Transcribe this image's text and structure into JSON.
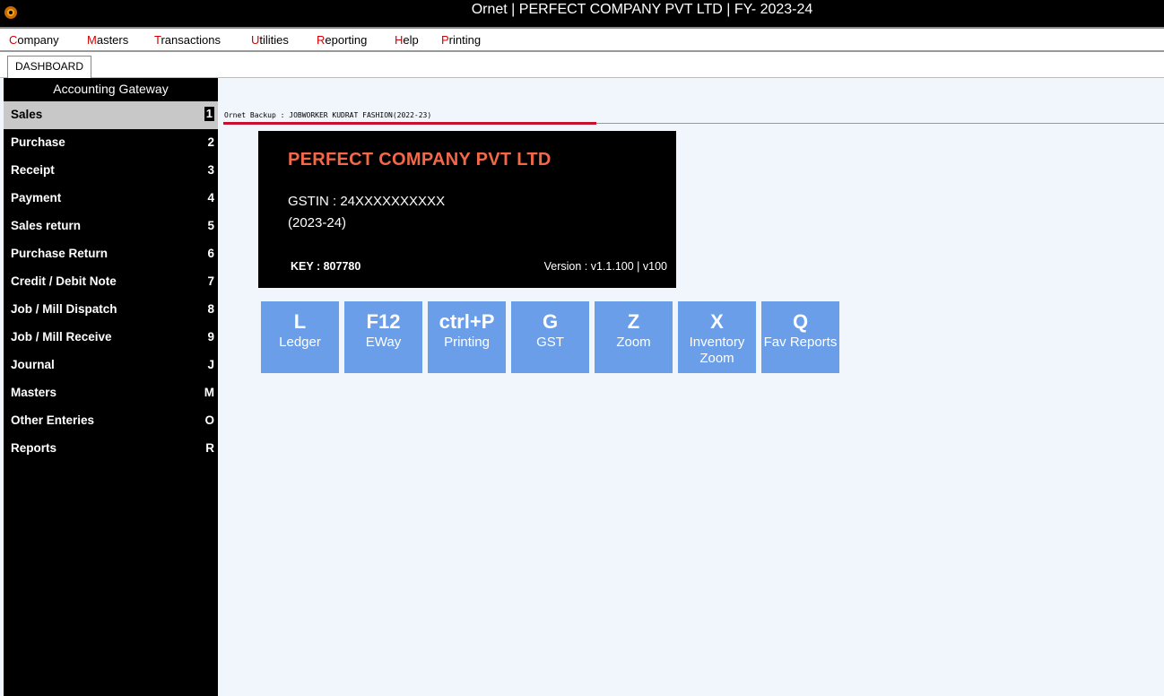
{
  "window": {
    "title": "Ornet | PERFECT COMPANY PVT LTD | FY- 2023-24",
    "icon": "app-logo-icon"
  },
  "menu": [
    {
      "acc": "C",
      "rest": "ompany"
    },
    {
      "acc": "M",
      "rest": "asters"
    },
    {
      "acc": "T",
      "rest": "ransactions"
    },
    {
      "acc": "U",
      "rest": "tilities"
    },
    {
      "acc": "R",
      "rest": "eporting"
    },
    {
      "acc": "H",
      "rest": "elp"
    },
    {
      "acc": "P",
      "rest": "rinting"
    }
  ],
  "tabs": [
    {
      "label": "DASHBOARD"
    }
  ],
  "sidebar": {
    "title": "Accounting Gateway",
    "items": [
      {
        "label": "Sales",
        "key": "1"
      },
      {
        "label": "Purchase",
        "key": "2"
      },
      {
        "label": "Receipt",
        "key": "3"
      },
      {
        "label": "Payment",
        "key": "4"
      },
      {
        "label": "Sales return",
        "key": "5"
      },
      {
        "label": "Purchase Return",
        "key": "6"
      },
      {
        "label": "Credit / Debit Note",
        "key": "7"
      },
      {
        "label": "Job / Mill Dispatch",
        "key": "8"
      },
      {
        "label": "Job / Mill Receive",
        "key": "9"
      },
      {
        "label": "Journal",
        "key": "J"
      },
      {
        "label": "Masters",
        "key": "M"
      },
      {
        "label": "Other Enteries",
        "key": "O"
      },
      {
        "label": "Reports",
        "key": "R"
      }
    ]
  },
  "backup": {
    "text": "Ornet Backup : JOBWORKER KUDRAT FASHION(2022-23)"
  },
  "company": {
    "name": "PERFECT COMPANY PVT LTD",
    "gstin": "GSTIN : 24XXXXXXXXXX",
    "fy": "(2023-24)",
    "key": "KEY : 807780",
    "version": "Version : v1.1.100 | v100"
  },
  "tiles": [
    {
      "key": "L",
      "label": "Ledger"
    },
    {
      "key": "F12",
      "label": "EWay"
    },
    {
      "key": "ctrl+P",
      "label": "Printing"
    },
    {
      "key": "G",
      "label": "GST"
    },
    {
      "key": "Z",
      "label": "Zoom"
    },
    {
      "key": "X",
      "label": "Inventory Zoom"
    },
    {
      "key": "Q",
      "label": "Fav Reports"
    }
  ],
  "colors": {
    "sidebar_bg": "#000000",
    "active_item_bg": "#c8c8c8",
    "tile_bg": "#6a9ee8",
    "company_name": "#f26848",
    "accent_red": "#c8102e"
  }
}
